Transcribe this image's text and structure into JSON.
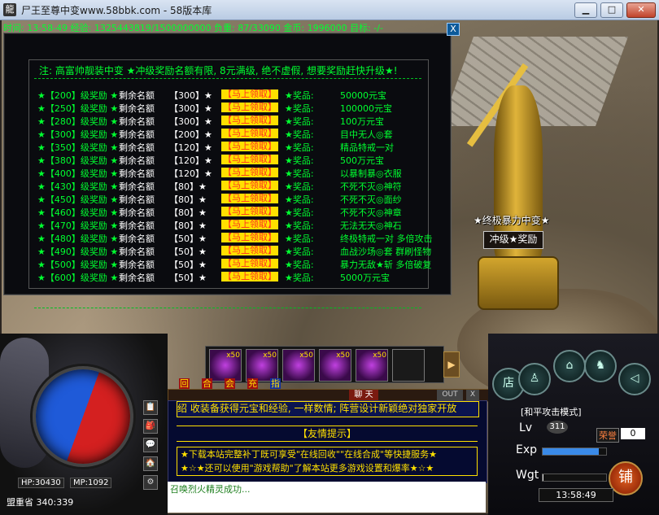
{
  "window": {
    "title": "尸王至尊中变www.58bbk.com - 58版本库",
    "minimize": "▁",
    "maximize": "□",
    "close": "✕"
  },
  "status_line": "时间: 13-58-49 经验: 1325443819/1500000000 负重: 87/33090 金币: 1996000 目标: -/-",
  "panel": {
    "close": "X",
    "notice": "注: 高富帅靓装中变 ★冲级奖励名额有限, 8元满级, 绝不虚假, 想要奖励赶快升级★!",
    "rows": [
      {
        "level": "★【200】级奖励 ★",
        "quota_label": "剩余名额",
        "quota": "【300】★",
        "claim": "【马上领取】",
        "prize_label": "★奖品:",
        "prize": "50000元宝"
      },
      {
        "level": "★【250】级奖励 ★",
        "quota_label": "剩余名额",
        "quota": "【300】★",
        "claim": "【马上领取】",
        "prize_label": "★奖品:",
        "prize": "100000元宝"
      },
      {
        "level": "★【280】级奖励 ★",
        "quota_label": "剩余名额",
        "quota": "【300】★",
        "claim": "【马上领取】",
        "prize_label": "★奖品:",
        "prize": "100万元宝"
      },
      {
        "level": "★【300】级奖励 ★",
        "quota_label": "剩余名额",
        "quota": "【200】★",
        "claim": "【马上领取】",
        "prize_label": "★奖品:",
        "prize": "目中无人◎套"
      },
      {
        "level": "★【350】级奖励 ★",
        "quota_label": "剩余名额",
        "quota": "【120】★",
        "claim": "【马上领取】",
        "prize_label": "★奖品:",
        "prize": "精品特戒一对"
      },
      {
        "level": "★【380】级奖励 ★",
        "quota_label": "剩余名额",
        "quota": "【120】★",
        "claim": "【马上领取】",
        "prize_label": "★奖品:",
        "prize": "500万元宝"
      },
      {
        "level": "★【400】级奖励 ★",
        "quota_label": "剩余名额",
        "quota": "【120】★",
        "claim": "【马上领取】",
        "prize_label": "★奖品:",
        "prize": "以暴制暴◎衣服"
      },
      {
        "level": "★【430】级奖励 ★",
        "quota_label": "剩余名额",
        "quota": "【80】★",
        "claim": "【马上领取】",
        "prize_label": "★奖品:",
        "prize": "不死不灭◎神符"
      },
      {
        "level": "★【450】级奖励 ★",
        "quota_label": "剩余名额",
        "quota": "【80】★",
        "claim": "【马上领取】",
        "prize_label": "★奖品:",
        "prize": "不死不灭◎面纱"
      },
      {
        "level": "★【460】级奖励 ★",
        "quota_label": "剩余名额",
        "quota": "【80】★",
        "claim": "【马上领取】",
        "prize_label": "★奖品:",
        "prize": "不死不灭◎神章"
      },
      {
        "level": "★【470】级奖励 ★",
        "quota_label": "剩余名额",
        "quota": "【80】★",
        "claim": "【马上领取】",
        "prize_label": "★奖品:",
        "prize": "无法无天◎神石"
      },
      {
        "level": "★【480】级奖励 ★",
        "quota_label": "剩余名额",
        "quota": "【50】★",
        "claim": "【马上领取】",
        "prize_label": "★奖品:",
        "prize": "终极特戒一对 多倍攻击"
      },
      {
        "level": "★【490】级奖励 ★",
        "quota_label": "剩余名额",
        "quota": "【50】★",
        "claim": "【马上领取】",
        "prize_label": "★奖品:",
        "prize": "血战沙场◎套 群刷怪物"
      },
      {
        "level": "★【500】级奖励 ★",
        "quota_label": "剩余名额",
        "quota": "【50】★",
        "claim": "【马上领取】",
        "prize_label": "★奖品:",
        "prize": "暴力无敌★斩 多倍破复"
      },
      {
        "level": "★【600】级奖励 ★",
        "quota_label": "剩余名额",
        "quota": "【50】★",
        "claim": "【马上领取】",
        "prize_label": "★奖品:",
        "prize": "5000万元宝"
      }
    ]
  },
  "npc": {
    "name": "★终极暴力中变★",
    "button": "冲级★奖励"
  },
  "hud": {
    "hp": "HP:30430",
    "mp": "MP:1092",
    "map": "盟重省  340:339",
    "side_icons": [
      "📋",
      "🎒",
      "💬",
      "🏠",
      "⚙"
    ],
    "slot_count": "x50",
    "tabs": [
      "回收",
      "合成",
      "会员",
      "充值",
      "指南"
    ],
    "chat_center": "聊 天",
    "chat_out": "OUT",
    "chat_x": "X",
    "chat_line1": "绍  收装备获得元宝和经验, 一样数情; 阵营设计新颖绝对独家开放",
    "chat_title": "【友情提示】",
    "chat_block1": "★下载本站完整补丁既可享受\"在线回收\"\"在线合成\"等快捷服务★",
    "chat_block2": "★☆★还可以使用\"游戏帮助\"了解本站更多游戏设置和爆率★☆★",
    "system_msg": "召唤烈火精灵成功...",
    "attack_mode": "[和平攻击模式]",
    "lv_label": "Lv",
    "lv_value": "311",
    "exp_label": "Exp",
    "exp_fill": 0.88,
    "wgt_label": "Wgt",
    "wgt_fill": 0.01,
    "honor_label": "荣誉",
    "honor_value": "0",
    "clock": "13:58:49",
    "shop_label": "铺",
    "store_btn": "店",
    "round_btns": [
      "♙",
      "⌂",
      "♞",
      "◁"
    ]
  },
  "colors": {
    "green": "#00ff30",
    "claim_bg": "#ffe000",
    "claim_fg": "#ff3020",
    "chat_yellow": "#ffe000"
  }
}
